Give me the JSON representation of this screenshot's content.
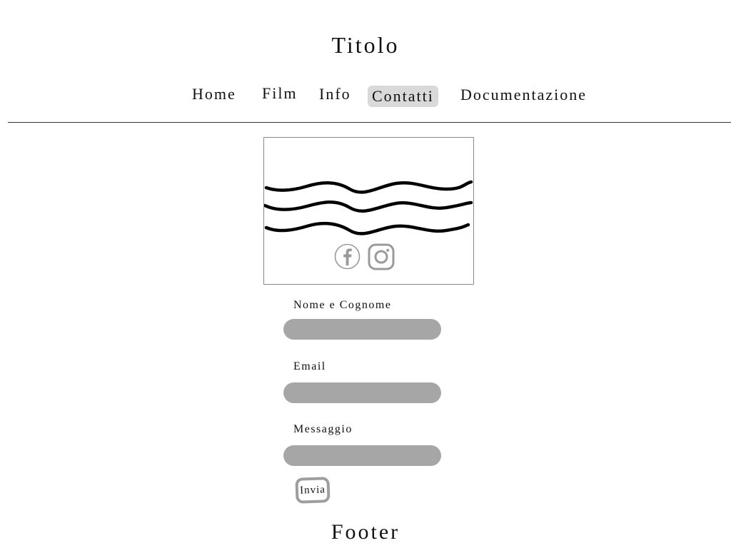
{
  "header": {
    "title": "Titolo"
  },
  "nav": {
    "items": [
      {
        "label": "Home"
      },
      {
        "label": "Film"
      },
      {
        "label": "Info"
      },
      {
        "label": "Contatti",
        "active": true
      },
      {
        "label": "Documentazione"
      }
    ],
    "active_bg": "#d9d9d9"
  },
  "hero": {
    "image": "waves-logo",
    "social_icons": [
      "facebook-icon",
      "instagram-icon"
    ]
  },
  "form": {
    "name_label": "Nome e Cognome",
    "name_value": "",
    "email_label": "Email",
    "email_value": "",
    "message_label": "Messaggio",
    "message_value": "",
    "submit_label": "Invia",
    "field_color": "#a6a6a6"
  },
  "footer": {
    "text": "Footer"
  }
}
